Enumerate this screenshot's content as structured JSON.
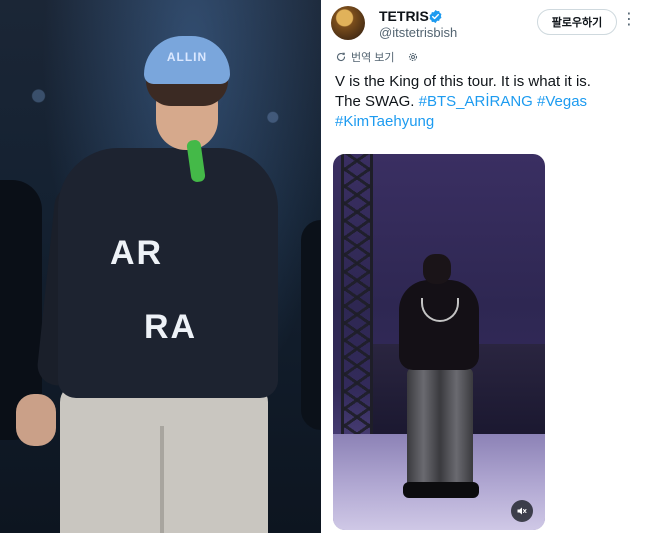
{
  "left_photo": {
    "beanie_text": "ALLIN",
    "hoodie_text_line1": "AR",
    "hoodie_text_line2": "RA"
  },
  "tweet": {
    "display_name": "TETRIS",
    "handle": "@itstetrisbish",
    "follow_label": "팔로우하기",
    "translate_label": "번역 보기",
    "text_line1": "V is the King of this tour. It is what it is.",
    "text_line2_plain": "The SWAG. ",
    "hashtags_line2": "#BTS_ARİRANG #Vegas",
    "hashtags_line3": "#KimTaehyung"
  },
  "colors": {
    "link": "#1d9bf0",
    "verified": "#1d9bf0",
    "text_primary": "#0f1419",
    "text_secondary": "#536471"
  },
  "icons": {
    "verified": "verified-badge-icon",
    "more": "more-icon",
    "translate": "translate-icon",
    "settings": "gear-icon",
    "mute": "speaker-muted-icon"
  }
}
